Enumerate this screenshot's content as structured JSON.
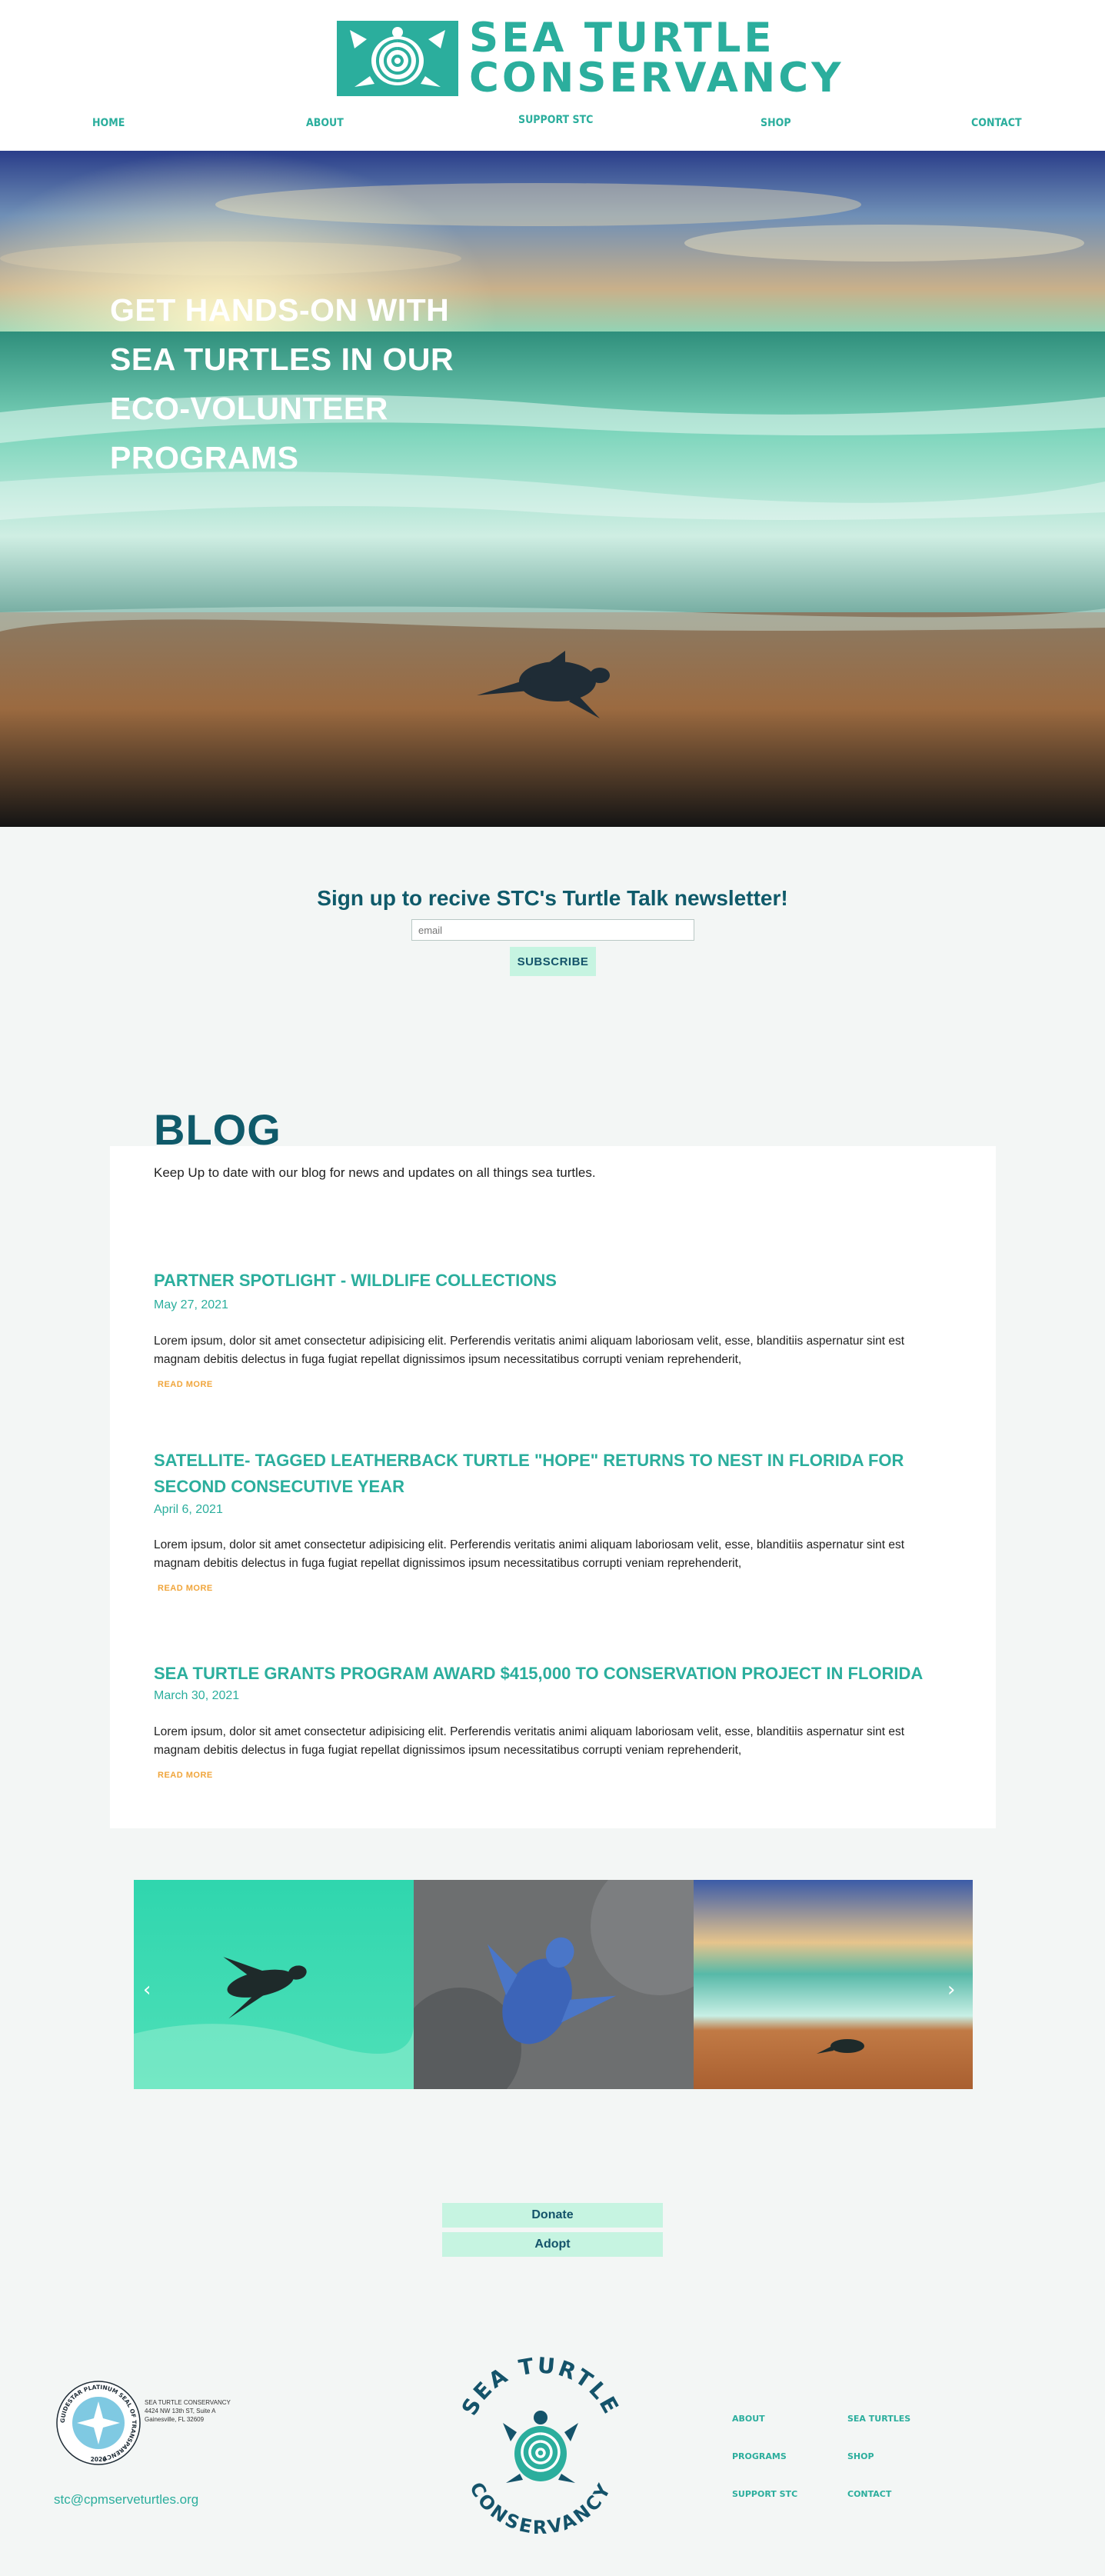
{
  "brand": {
    "name_line1": "SEA TURTLE",
    "name_line2": "CONSERVANCY",
    "color_primary": "#2bae9d",
    "color_dark": "#0f5a6a",
    "color_accent": "#f0a53b",
    "color_button": "#c6f4e1"
  },
  "nav": {
    "items": [
      {
        "label": "HOME"
      },
      {
        "label": "ABOUT"
      },
      {
        "label": "SUPPORT STC"
      },
      {
        "label": "SHOP"
      },
      {
        "label": "CONTACT"
      }
    ]
  },
  "hero": {
    "headline": "GET HANDS-ON WITH SEA TURTLES IN OUR ECO-VOLUNTEER PROGRAMS"
  },
  "newsletter": {
    "title": "Sign up to recive STC's Turtle Talk newsletter!",
    "email_placeholder": "email",
    "subscribe_label": "SUBSCRIBE"
  },
  "blog": {
    "title": "BLOG",
    "intro": "Keep Up to date with our blog for news and updates on all things sea turtles.",
    "read_more_label": "READ MORE",
    "posts": [
      {
        "title": "PARTNER SPOTLIGHT - WILDLIFE COLLECTIONS",
        "date": "May 27, 2021",
        "excerpt": "Lorem ipsum, dolor sit amet consectetur adipisicing elit. Perferendis veritatis animi aliquam laboriosam velit, esse, blanditiis aspernatur sint est magnam debitis delectus in fuga fugiat repellat dignissimos ipsum necessitatibus corrupti veniam reprehenderit,"
      },
      {
        "title": "SATELLITE- TAGGED LEATHERBACK TURTLE \"HOPE\" RETURNS TO NEST IN FLORIDA FOR SECOND CONSECUTIVE YEAR",
        "date": "April 6, 2021",
        "excerpt": "Lorem ipsum, dolor sit amet consectetur adipisicing elit. Perferendis veritatis animi aliquam laboriosam velit, esse, blanditiis aspernatur sint est magnam debitis delectus in fuga fugiat repellat dignissimos ipsum necessitatibus corrupti veniam reprehenderit,"
      },
      {
        "title": "SEA TURTLE GRANTS PROGRAM AWARD $415,000 TO CONSERVATION PROJECT IN FLORIDA",
        "date": "March 30, 2021",
        "excerpt": "Lorem ipsum, dolor sit amet consectetur adipisicing elit. Perferendis veritatis animi aliquam laboriosam velit, esse, blanditiis aspernatur sint est magnam debitis delectus in fuga fugiat repellat dignissimos ipsum necessitatibus corrupti veniam reprehenderit,"
      }
    ]
  },
  "gallery": {
    "prev_icon": "‹",
    "next_icon": "›"
  },
  "cta": {
    "donate_label": "Donate",
    "adopt_label": "Adopt"
  },
  "footer": {
    "seal_text": "GUIDESTAR PLATINUM SEAL OF TRANSPARENCY",
    "seal_year": "2020",
    "address_name": "SEA TURTLE CONSERVANCY",
    "address_street": "4424 NW 13th ST, Suite A",
    "address_city": "Gainesville, FL 32609",
    "email": "stc@cpmserveturtles.org",
    "logo_top": "SEA TURTLE",
    "logo_bottom": "CONSERVANCY",
    "links": [
      {
        "label": "ABOUT"
      },
      {
        "label": "SEA TURTLES"
      },
      {
        "label": "PROGRAMS"
      },
      {
        "label": "SHOP"
      },
      {
        "label": "SUPPORT STC"
      },
      {
        "label": "CONTACT"
      }
    ]
  }
}
